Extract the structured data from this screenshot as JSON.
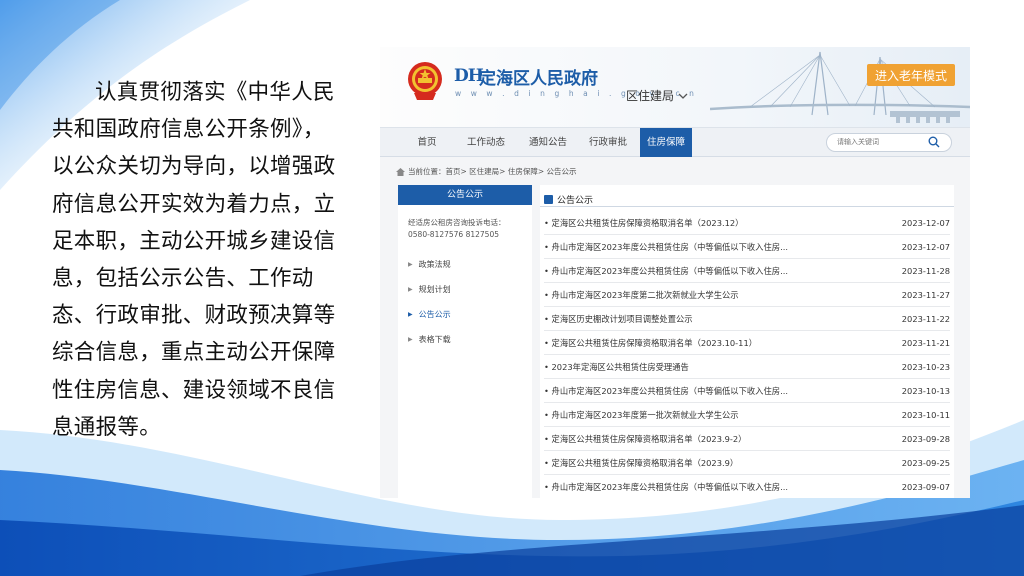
{
  "slide": {
    "paragraph": "认真贯彻落实《中华人民共和国政府信息公开条例》，以公众关切为导向，以增强政府信息公开实效为着力点，立足本职，主动公开城乡建设信息，包括公示公告、工作动态、行政审批、财政预决算等综合信息，重点主动公开保障性住房信息、建设领域不良信息通报等。"
  },
  "site": {
    "logo_mark": "DH",
    "title": "定海区人民政府",
    "domain": "w w w . d i n g h a i . g o v . c n",
    "department": "区住建局",
    "elder_mode": "进入老年模式",
    "colors": {
      "primary": "#1d5da8",
      "accent": "#f0a233"
    }
  },
  "nav": {
    "items": [
      "首页",
      "工作动态",
      "通知公告",
      "行政审批",
      "住房保障"
    ],
    "active": "住房保障",
    "search_placeholder": "请输入关键词"
  },
  "breadcrumb": "当前位置：首页> 区住建局> 住房保障> 公告公示",
  "sidebar": {
    "heading": "公告公示",
    "hotline": "经适房公租房咨询投诉电话：0580-8127576 8127505",
    "items": [
      "政策法规",
      "规划计划",
      "公告公示",
      "表格下载"
    ],
    "active": "公告公示"
  },
  "main": {
    "heading": "公告公示",
    "rows": [
      {
        "title": "• 定海区公共租赁住房保障资格取消名单（2023.12）",
        "date": "2023-12-07"
      },
      {
        "title": "• 舟山市定海区2023年度公共租赁住房（中等偏低以下收入住房...",
        "date": "2023-12-07"
      },
      {
        "title": "• 舟山市定海区2023年度公共租赁住房（中等偏低以下收入住房...",
        "date": "2023-11-28"
      },
      {
        "title": "• 舟山市定海区2023年度第二批次新就业大学生公示",
        "date": "2023-11-27"
      },
      {
        "title": "• 定海区历史棚改计划项目调整处置公示",
        "date": "2023-11-22"
      },
      {
        "title": "• 定海区公共租赁住房保障资格取消名单（2023.10-11）",
        "date": "2023-11-21"
      },
      {
        "title": "• 2023年定海区公共租赁住房受理通告",
        "date": "2023-10-23"
      },
      {
        "title": "• 舟山市定海区2023年度公共租赁住房（中等偏低以下收入住房...",
        "date": "2023-10-13"
      },
      {
        "title": "• 舟山市定海区2023年度第一批次新就业大学生公示",
        "date": "2023-10-11"
      },
      {
        "title": "• 定海区公共租赁住房保障资格取消名单（2023.9-2）",
        "date": "2023-09-28"
      },
      {
        "title": "• 定海区公共租赁住房保障资格取消名单（2023.9）",
        "date": "2023-09-25"
      },
      {
        "title": "• 舟山市定海区2023年度公共租赁住房（中等偏低以下收入住房...",
        "date": "2023-09-07"
      }
    ]
  }
}
